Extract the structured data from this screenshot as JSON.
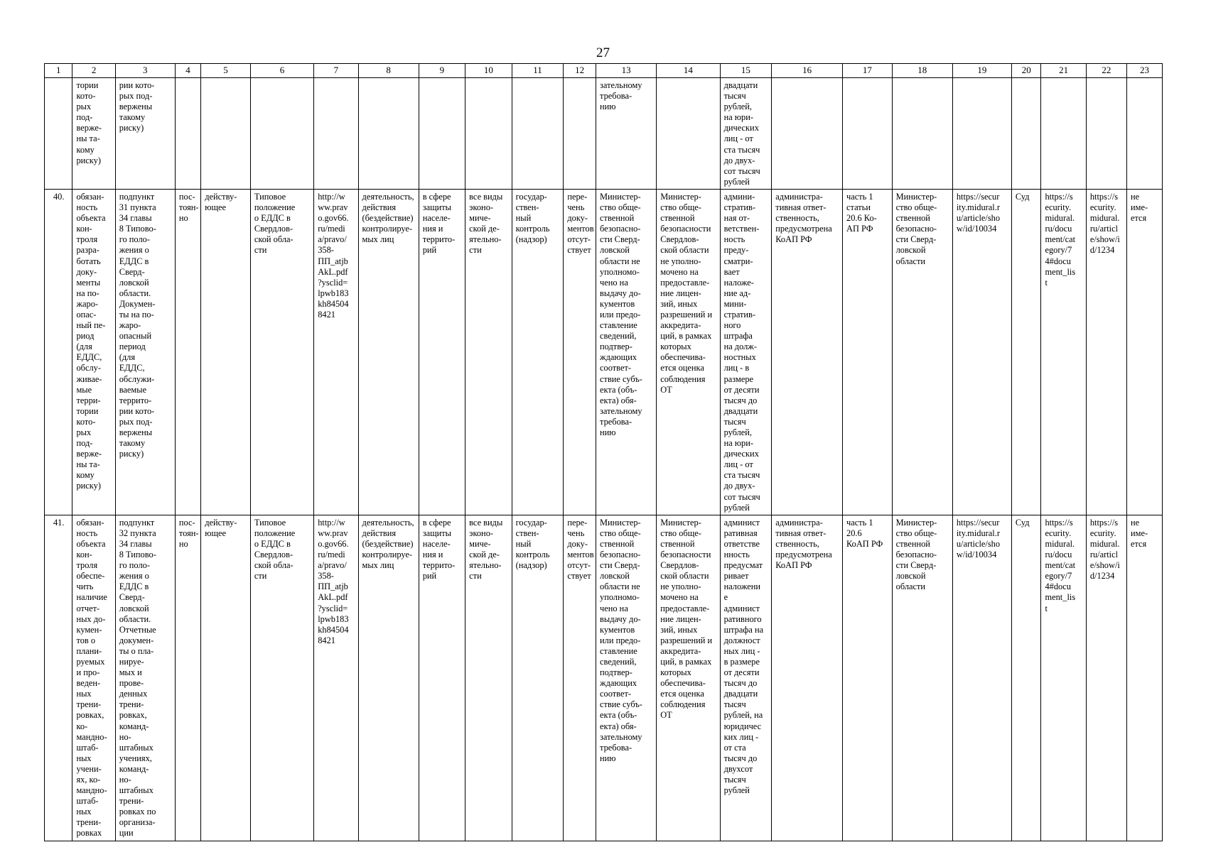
{
  "page": {
    "number": "27"
  },
  "table": {
    "headers": [
      "1",
      "2",
      "3",
      "4",
      "5",
      "6",
      "7",
      "8",
      "9",
      "10",
      "11",
      "12",
      "13",
      "14",
      "15",
      "16",
      "17",
      "18",
      "19",
      "20",
      "21",
      "22",
      "23"
    ],
    "rows": [
      {
        "name": "continuation-row",
        "cells": [
          "",
          "тории\nкото-\nрых\nпод-\nверже-\nны та-\nкому\nриску)",
          "рии кото-\nрых под-\nвержены\nтакому\nриску)",
          "",
          "",
          "",
          "",
          "",
          "",
          "",
          "",
          "",
          "зательному\nтребова-\nнию",
          "",
          "двадцати\nтысяч\nрублей,\nна юри-\nдических\nлиц - от\nста тысяч\nдо двух-\nсот тысяч\nрублей",
          "",
          "",
          "",
          "",
          "",
          "",
          "",
          ""
        ]
      },
      {
        "name": "row-40",
        "cells": [
          "40.",
          "обязан-\nность\nобъекта\nкон-\nтроля\nразра-\nботать\nдоку-\nменты\nна по-\nжаро-\nопас-\nный пе-\nриод\n(для\nЕДДС,\nобслу-\nживае-\nмые\nтерри-\nтории\nкото-\nрых\nпод-\nверже-\nны та-\nкому\nриску)",
          "подпункт\n31 пункта\n34 главы\n8 Типово-\nго поло-\nжения о\nЕДДС в\nСверд-\nловской\nобласти.\nДокумен-\nты на по-\nжаро-\nопасный\nпериод\n(для\nЕДДС,\nобслужи-\nваемые\nтеррито-\nрии кото-\nрых под-\nвержены\nтакому\nриску)",
          "пос-\nтоян-\nно",
          "действу-\nющее",
          "Типовое\nположение\nо ЕДДС в\nСвердлов-\nской обла-\nсти",
          "http://w\nww.prav\no.gov66.\nru/medi\na/pravo/\n358-\nПП_atjb\nAkL.pdf\n?ysclid=\nlpwb183\nkh84504\n8421",
          "деятельность,\nдействия\n(бездействие)\nконтролируе-\nмых лиц",
          "в сфере\nзащиты\nнаселе-\nния и\nтеррито-\nрий",
          "все виды\nэконо-\nмиче-\nской де-\nятельно-\nсти",
          "государ-\nствен-\nный\nконтроль\n(надзор)",
          "пере-\nчень\nдоку-\nментов\nотсут-\nствует",
          "Министер-\nство обще-\nственной\nбезопасно-\nсти Сверд-\nловской\nобласти не\nуполномо-\nчено на\nвыдачу до-\nкументов\nили предо-\nставление\nсведений,\nподтвер-\nждающих\nсоответ-\nствие субъ-\nекта (объ-\nекта) обя-\nзательному\nтребова-\nнию",
          "Министер-\nство обще-\nственной\nбезопасности\nСвердлов-\nской области\nне уполно-\nмочено на\nпредоставле-\nние лицен-\nзий, иных\nразрешений и\nаккредита-\nций, в рамках\nкоторых\nобеспечива-\nется оценка\nсоблюдения\nОТ",
          "админи-\nстратив-\nная от-\nветствен-\nность\nпреду-\nсматри-\nвает\nналоже-\nние ад-\nмини-\nстратив-\nного\nштрафа\nна долж-\nностных\nлиц - в\nразмере\nот десяти\nтысяч до\nдвадцати\nтысяч\nрублей,\nна юри-\nдических\nлиц - от\nста тысяч\nдо двух-\nсот тысяч\nрублей",
          "администра-\nтивная ответ-\nственность,\nпредусмотрена\nКоАП РФ",
          "часть 1\nстатьи\n20.6 Ко-\nАП РФ",
          "Министер-\nство обще-\nственной\nбезопасно-\nсти Сверд-\nловской\nобласти",
          "https://secur\nity.midural.r\nu/article/sho\nw/id/10034",
          "Суд",
          "https://s\necurity.\nmidural.\nru/docu\nment/cat\negory/7\n4#docu\nment_lis\nt",
          "https://s\necurity.\nmidural.\nru/articl\ne/show/i\nd/1234",
          "не\nиме-\nется"
        ]
      },
      {
        "name": "row-41",
        "cells": [
          "41.",
          "обязан-\nность\nобъекта\nкон-\nтроля\nобеспе-\nчить\nналичие\nотчет-\nных до-\nкумен-\nтов о\nплани-\nруемых\nи про-\nведен-\nных\nтрени-\nровках,\nко-\nмандно-\nштаб-\nных\nучени-\nях, ко-\nмандно-\nштаб-\nных\nтрени-\nровках",
          "подпункт\n32 пункта\n34 главы\n8 Типово-\nго поло-\nжения о\nЕДДС в\nСверд-\nловской\nобласти.\nОтчетные\nдокумен-\nты о пла-\nнируе-\nмых и\nпрове-\nденных\nтрени-\nровках,\nкоманд-\nно-\nштабных\nучениях,\nкоманд-\nно-\nштабных\nтрени-\nровках по\nорганиза-\nции",
          "пос-\nтоян-\nно",
          "действу-\nющее",
          "Типовое\nположение\nо ЕДДС в\nСвердлов-\nской обла-\nсти",
          "http://w\nww.prav\no.gov66.\nru/medi\na/pravo/\n358-\nПП_atjb\nAkL.pdf\n?ysclid=\nlpwb183\nkh84504\n8421",
          "деятельность,\nдействия\n(бездействие)\nконтролируе-\nмых лиц",
          "в сфере\nзащиты\nнаселе-\nния и\nтеррито-\nрий",
          "все виды\nэконо-\nмиче-\nской де-\nятельно-\nсти",
          "государ-\nствен-\nный\nконтроль\n(надзор)",
          "пере-\nчень\nдоку-\nментов\nотсут-\nствует",
          "Министер-\nство обще-\nственной\nбезопасно-\nсти Сверд-\nловской\nобласти не\nуполномо-\nчено на\nвыдачу до-\nкументов\nили предо-\nставление\nсведений,\nподтвер-\nждающих\nсоответ-\nствие субъ-\nекта (объ-\nекта) обя-\nзательному\nтребова-\nнию",
          "Министер-\nство обще-\nственной\nбезопасности\nСвердлов-\nской области\nне уполно-\nмочено на\nпредоставле-\nние лицен-\nзий, иных\nразрешений и\nаккредита-\nций, в рамках\nкоторых\nобеспечива-\nется оценка\nсоблюдения\nОТ",
          "админист\nративная\nответстве\nнность\nпредусмат\nривает\nналожени\nе\nадминист\nративного\nштрафа на\nдолжност\nных лиц -\nв размере\nот десяти\nтысяч до\nдвадцати\nтысяч\nрублей, на\nюридичес\nких лиц -\nот ста\nтысяч до\nдвухсот\nтысяч\nрублей",
          "администра-\nтивная ответ-\nственность,\nпредусмотрена\nКоАП РФ",
          "часть 1\n20.6\nКоАП РФ",
          "Министер-\nство обще-\nственной\nбезопасно-\nсти Сверд-\nловской\nобласти",
          "https://secur\nity.midural.r\nu/article/sho\nw/id/10034",
          "Суд",
          "https://s\necurity.\nmidural.\nru/docu\nment/cat\negory/7\n4#docu\nment_lis\nt",
          "https://s\necurity.\nmidural.\nru/articl\ne/show/i\nd/1234",
          "не\nиме-\nется"
        ]
      }
    ]
  }
}
